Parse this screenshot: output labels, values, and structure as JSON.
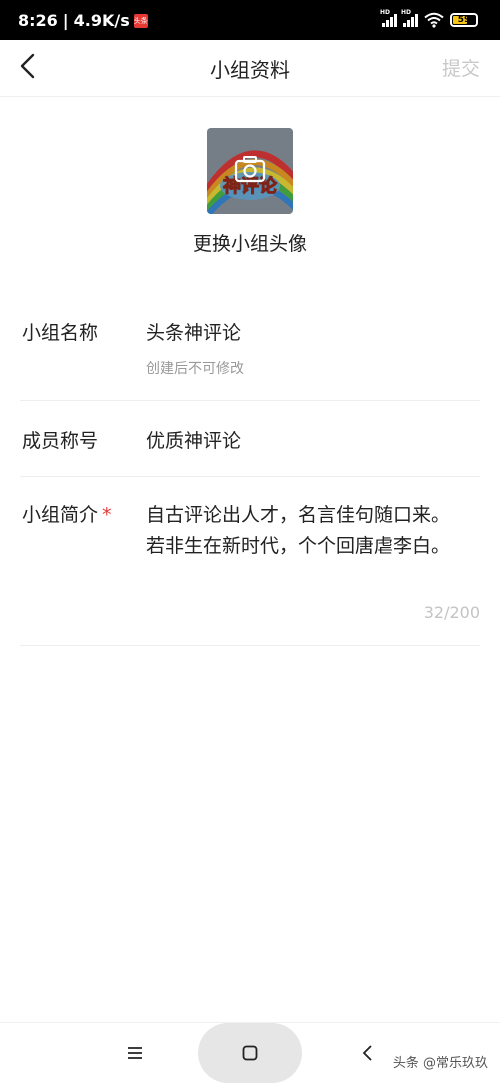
{
  "status_bar": {
    "time": "8:26",
    "separator": "|",
    "net_speed": "4.9K/s",
    "app_badge": "头条",
    "signal_label": "HD",
    "battery_level": "59"
  },
  "header": {
    "title": "小组资料",
    "submit_label": "提交"
  },
  "avatar": {
    "image_text": "神评论",
    "change_label": "更换小组头像"
  },
  "form": {
    "name": {
      "label": "小组名称",
      "value": "头条神评论",
      "hint": "创建后不可修改"
    },
    "member_title": {
      "label": "成员称号",
      "value": "优质神评论"
    },
    "intro": {
      "label": "小组简介",
      "required_mark": "*",
      "value": "自古评论出人才，名言佳句随口来。若非生在新时代，个个回唐虐李白。",
      "counter": "32/200"
    }
  },
  "watermark": "头条 @常乐玖玖",
  "colors": {
    "required": "#e53935",
    "submit_disabled": "#c8c8c8",
    "hint": "#999999",
    "counter": "#c4c4c4"
  }
}
